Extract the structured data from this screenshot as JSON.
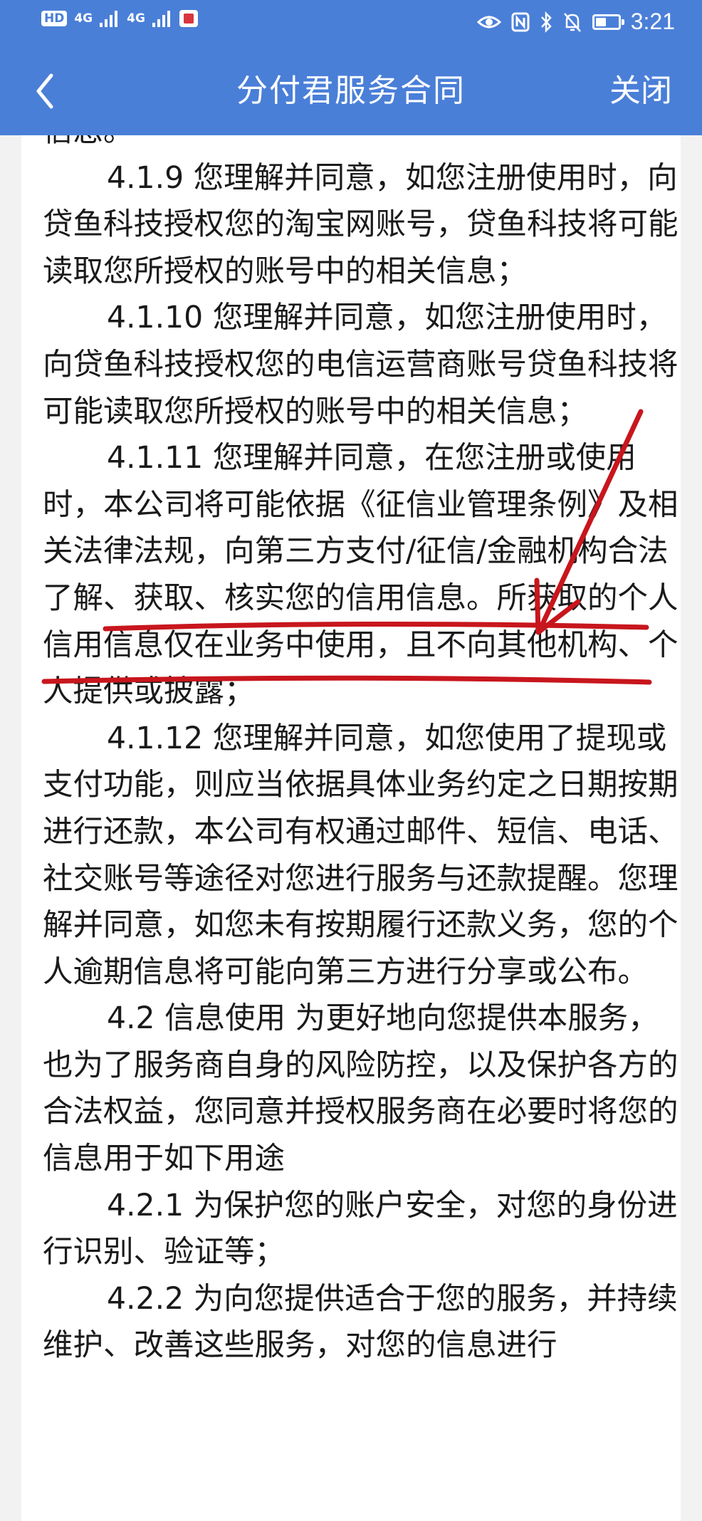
{
  "status_bar": {
    "hd": "HD",
    "network1": "4G",
    "network2": "4G",
    "time": "3:21"
  },
  "nav": {
    "title": "分付君服务合同",
    "close_label": "关闭"
  },
  "document": {
    "paragraphs": [
      {
        "text": "信息。"
      },
      {
        "text": "4.1.9 您理解并同意，如您注册使用时，向贷鱼科技授权您的淘宝网账号，贷鱼科技将可能读取您所授权的账号中的相关信息；"
      },
      {
        "text": "4.1.10 您理解并同意，如您注册使用时，向贷鱼科技授权您的电信运营商账号贷鱼科技将可能读取您所授权的账号中的相关信息；"
      },
      {
        "text": "4.1.11 您理解并同意，在您注册或使用时，本公司将可能依据《征信业管理条例》及相关法律法规，向第三方支付/征信/金融机构合法了解、获取、核实您的信用信息。所获取的个人信用信息仅在业务中使用，且不向其他机构、个人提供或披露；"
      },
      {
        "text": "4.1.12 您理解并同意，如您使用了提现或支付功能，则应当依据具体业务约定之日期按期进行还款，本公司有权通过邮件、短信、电话、社交账号等途径对您进行服务与还款提醒。您理解并同意，如您未有按期履行还款义务，您的个人逾期信息将可能向第三方进行分享或公布。"
      },
      {
        "text": "4.2 信息使用 为更好地向您提供本服务，也为了服务商自身的风险防控，以及保护各方的合法权益，您同意并授权服务商在必要时将您的信息用于如下用途"
      },
      {
        "text": "4.2.1 为保护您的账户安全，对您的身份进行识别、验证等；"
      },
      {
        "text": "4.2.2 为向您提供适合于您的服务，并持续维护、改善这些服务，对您的信息进行"
      }
    ]
  },
  "colors": {
    "nav_bg": "#4a7fd8",
    "annotation": "#c8161d"
  },
  "icons": {
    "back": "chevron-left-icon",
    "eye": "eye-icon",
    "nfc": "nfc-icon",
    "bluetooth": "bluetooth-icon",
    "mute": "bell-off-icon",
    "battery": "battery-icon"
  }
}
